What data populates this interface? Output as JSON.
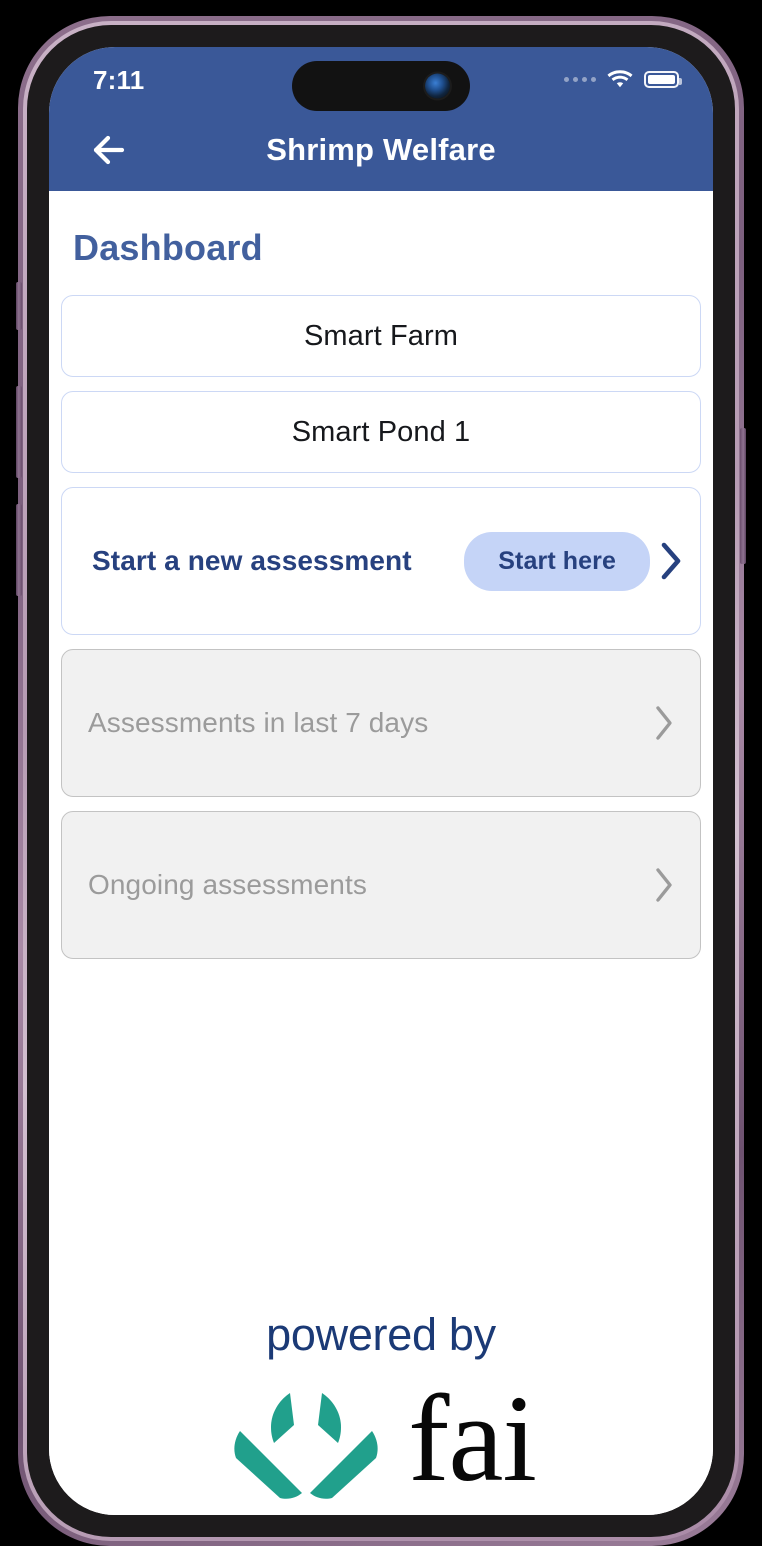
{
  "status_bar": {
    "time": "7:11",
    "wifi_icon": "wifi-icon",
    "battery_icon": "battery-full-icon",
    "signal_icon": "signal-dots-icon"
  },
  "app_bar": {
    "back_icon": "arrow-left-icon",
    "title": "Shrimp Welfare"
  },
  "page": {
    "heading": "Dashboard"
  },
  "selectors": [
    {
      "label": "Smart Farm"
    },
    {
      "label": "Smart Pond 1"
    }
  ],
  "new_assessment": {
    "label": "Start a new assessment",
    "button_label": "Start here",
    "chevron_icon": "chevron-right-icon"
  },
  "muted_rows": [
    {
      "label": "Assessments in last 7 days",
      "chevron_icon": "chevron-right-icon"
    },
    {
      "label": "Ongoing assessments",
      "chevron_icon": "chevron-right-icon"
    }
  ],
  "footer": {
    "powered_by": "powered by",
    "brand": "fai",
    "logo_icon": "fai-leaf-logo-icon"
  },
  "colors": {
    "app_bar_blue": "#3a5898",
    "heading_blue": "#42609e",
    "accent_navy": "#27417f",
    "pill_blue": "#c5d4f7",
    "card_border_blue": "#ccd8f5",
    "muted_grey": "#9b9b9b",
    "muted_bg": "#f1f1f1",
    "logo_teal": "#21a08c",
    "powered_navy": "#1b3a76"
  }
}
